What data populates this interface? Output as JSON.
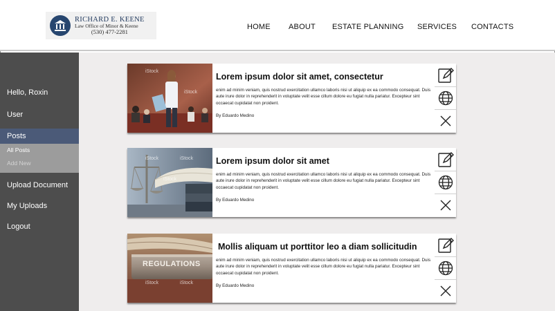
{
  "brand": {
    "name": "RICHARD E. KEENE",
    "firm": "Law Office of Minor & Keene",
    "phone": "(530) 477-2281"
  },
  "nav": [
    "HOME",
    "ABOUT",
    "ESTATE PLANNING",
    "SERVICES",
    "CONTACTS"
  ],
  "sidebar": {
    "greeting": "Hello, Roxin",
    "user": "User",
    "posts": "Posts",
    "sub": [
      "All Posts",
      "Add New"
    ],
    "upload": "Upload Document",
    "my_uploads": "My Uploads",
    "logout": "Logout"
  },
  "posts": [
    {
      "title": "Lorem ipsum dolor sit amet, consectetur",
      "body": "enim ad minim veniam, quis nostrud exercitation ullamco laboris nisi ut aliquip ex ea commodo consequat. Duis aute irure dolor in reprehenderit in voluptate velit esse cillum dolore eu fugiat nulla pariatur. Excepteur sint occaecat cupidatat non proident.",
      "author": "By Eduardo Medino",
      "image": "speaker-in-courtroom"
    },
    {
      "title": "Lorem ipsum dolor sit amet",
      "body": "enim ad minim veniam, quis nostrud exercitation ullamco laboris nisi ut aliquip ex ea commodo consequat. Duis aute irure dolor in reprehenderit in voluptate velit esse cillum dolore eu fugiat nulla pariatur. Excepteur sint occaecat cupidatat non proident.",
      "author": "By Eduardo Medino",
      "image": "scales-and-books"
    },
    {
      "title": "Mollis aliquam ut porttitor leo a diam sollicitudin",
      "body": "enim ad minim veniam, quis nostrud exercitation ullamco laboris nisi ut aliquip ex ea commodo consequat. Duis aute irure dolor in reprehenderit in voluptate velit esse cillum dolore eu fugiat nulla pariatur. Excepteur sint occaecat cupidatat non proident.",
      "author": "By Eduardo Medino",
      "image": "regulations-book",
      "image_label": "REGULATIONS"
    }
  ],
  "watermark": "iStock",
  "colors": {
    "sidebar": "#4d4d4d",
    "active": "#4b5a78",
    "submenu": "#9c9c9c",
    "main_bg": "#efeded",
    "brand": "#27466f"
  }
}
